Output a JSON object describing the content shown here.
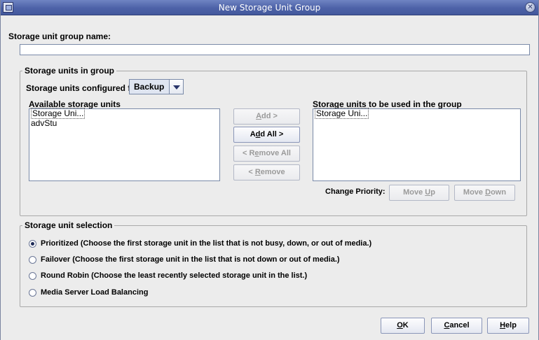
{
  "window": {
    "title": "New Storage Unit Group"
  },
  "name_field": {
    "label": "Storage unit group name:",
    "value": ""
  },
  "units_group": {
    "legend": "Storage units in group",
    "configured_label": "Storage units configured for:",
    "configured_value": "Backup",
    "available_label": "Available storage units",
    "available_items": [
      "Storage Uni...",
      "advStu"
    ],
    "used_label": "Storage units to be used in the group",
    "used_items": [
      "Storage Uni..."
    ],
    "buttons": {
      "add": {
        "pre": "",
        "mnemonic": "A",
        "post": "dd >"
      },
      "add_all": {
        "pre": "A",
        "mnemonic": "d",
        "post": "d All >"
      },
      "remove_all": {
        "pre": "< R",
        "mnemonic": "e",
        "post": "move All"
      },
      "remove": {
        "pre": "< ",
        "mnemonic": "R",
        "post": "emove"
      }
    },
    "priority_label": "Change Priority:",
    "move_up": {
      "pre": "Move ",
      "mnemonic": "U",
      "post": "p"
    },
    "move_down": {
      "pre": "Move ",
      "mnemonic": "D",
      "post": "own"
    }
  },
  "selection_group": {
    "legend": "Storage unit selection",
    "options": [
      {
        "label": "Prioritized (Choose the first storage unit in the list that is not busy, down, or out of media.)",
        "checked": true
      },
      {
        "label": "Failover (Choose the first storage unit in the list that is not down or out of media.)",
        "checked": false
      },
      {
        "label": "Round Robin (Choose the least recently selected storage unit in the list.)",
        "checked": false
      },
      {
        "label": "Media Server Load Balancing",
        "checked": false
      }
    ]
  },
  "footer": {
    "ok": {
      "mnemonic": "O",
      "post": "K"
    },
    "cancel": {
      "mnemonic": "C",
      "post": "ancel"
    },
    "help": {
      "mnemonic": "H",
      "post": "elp"
    }
  },
  "icons": {
    "window_icon": "window-icon",
    "close": "close-icon",
    "dropdown": "chevron-down-icon"
  }
}
